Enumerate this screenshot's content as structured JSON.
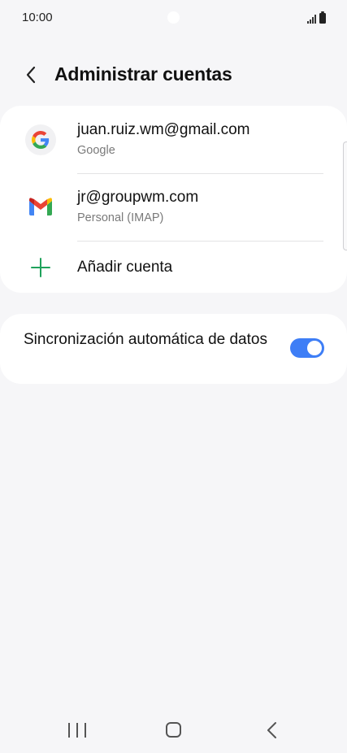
{
  "status_bar": {
    "time": "10:00"
  },
  "header": {
    "title": "Administrar cuentas"
  },
  "accounts": [
    {
      "email": "juan.ruiz.wm@gmail.com",
      "type": "Google",
      "icon": "google-icon"
    },
    {
      "email": "jr@groupwm.com",
      "type": "Personal (IMAP)",
      "icon": "gmail-icon"
    }
  ],
  "add_account": {
    "label": "Añadir cuenta",
    "icon": "plus-icon"
  },
  "sync": {
    "label": "Sincronización automática de datos",
    "enabled": true
  },
  "colors": {
    "accent": "#3e7ef6",
    "plus": "#1fa25b",
    "background": "#f6f6f8",
    "card": "#ffffff"
  }
}
